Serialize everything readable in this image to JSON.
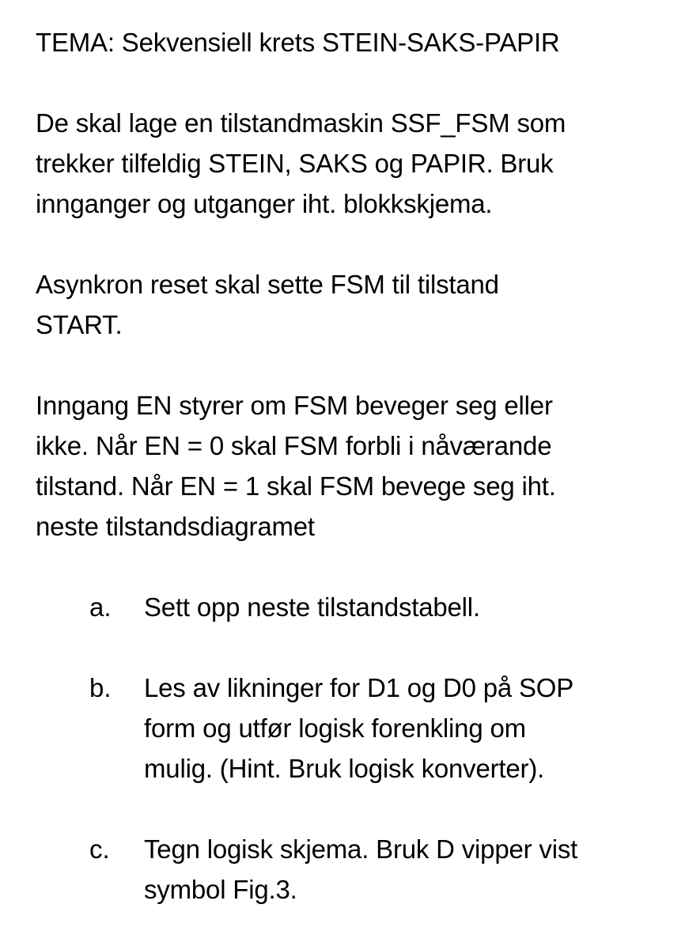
{
  "title": "TEMA: Sekvensiell krets STEIN-SAKS-PAPIR",
  "paragraphs": [
    {
      "lines": [
        "De skal lage en tilstandmaskin SSF_FSM som",
        "trekker tilfeldig STEIN, SAKS og PAPIR. Bruk",
        "innganger og utganger iht. blokkskjema."
      ]
    },
    {
      "lines": [
        "Asynkron reset skal sette FSM til tilstand",
        "START."
      ]
    },
    {
      "lines": [
        "Inngang EN styrer om FSM beveger seg eller",
        "ikke. Når EN = 0 skal FSM forbli i nåværande",
        "tilstand. Når EN = 1 skal FSM bevege seg iht.",
        "neste tilstandsdiagramet"
      ]
    }
  ],
  "tasks": [
    {
      "marker": "a.",
      "lines": [
        "Sett opp neste tilstandstabell."
      ]
    },
    {
      "marker": "b.",
      "lines": [
        "Les av likninger for D1 og D0 på SOP",
        "form og utfør logisk forenkling om",
        "mulig. (Hint. Bruk logisk konverter)."
      ]
    },
    {
      "marker": "c.",
      "lines": [
        "Tegn logisk skjema. Bruk D vipper vist",
        "symbol Fig.3."
      ]
    }
  ]
}
